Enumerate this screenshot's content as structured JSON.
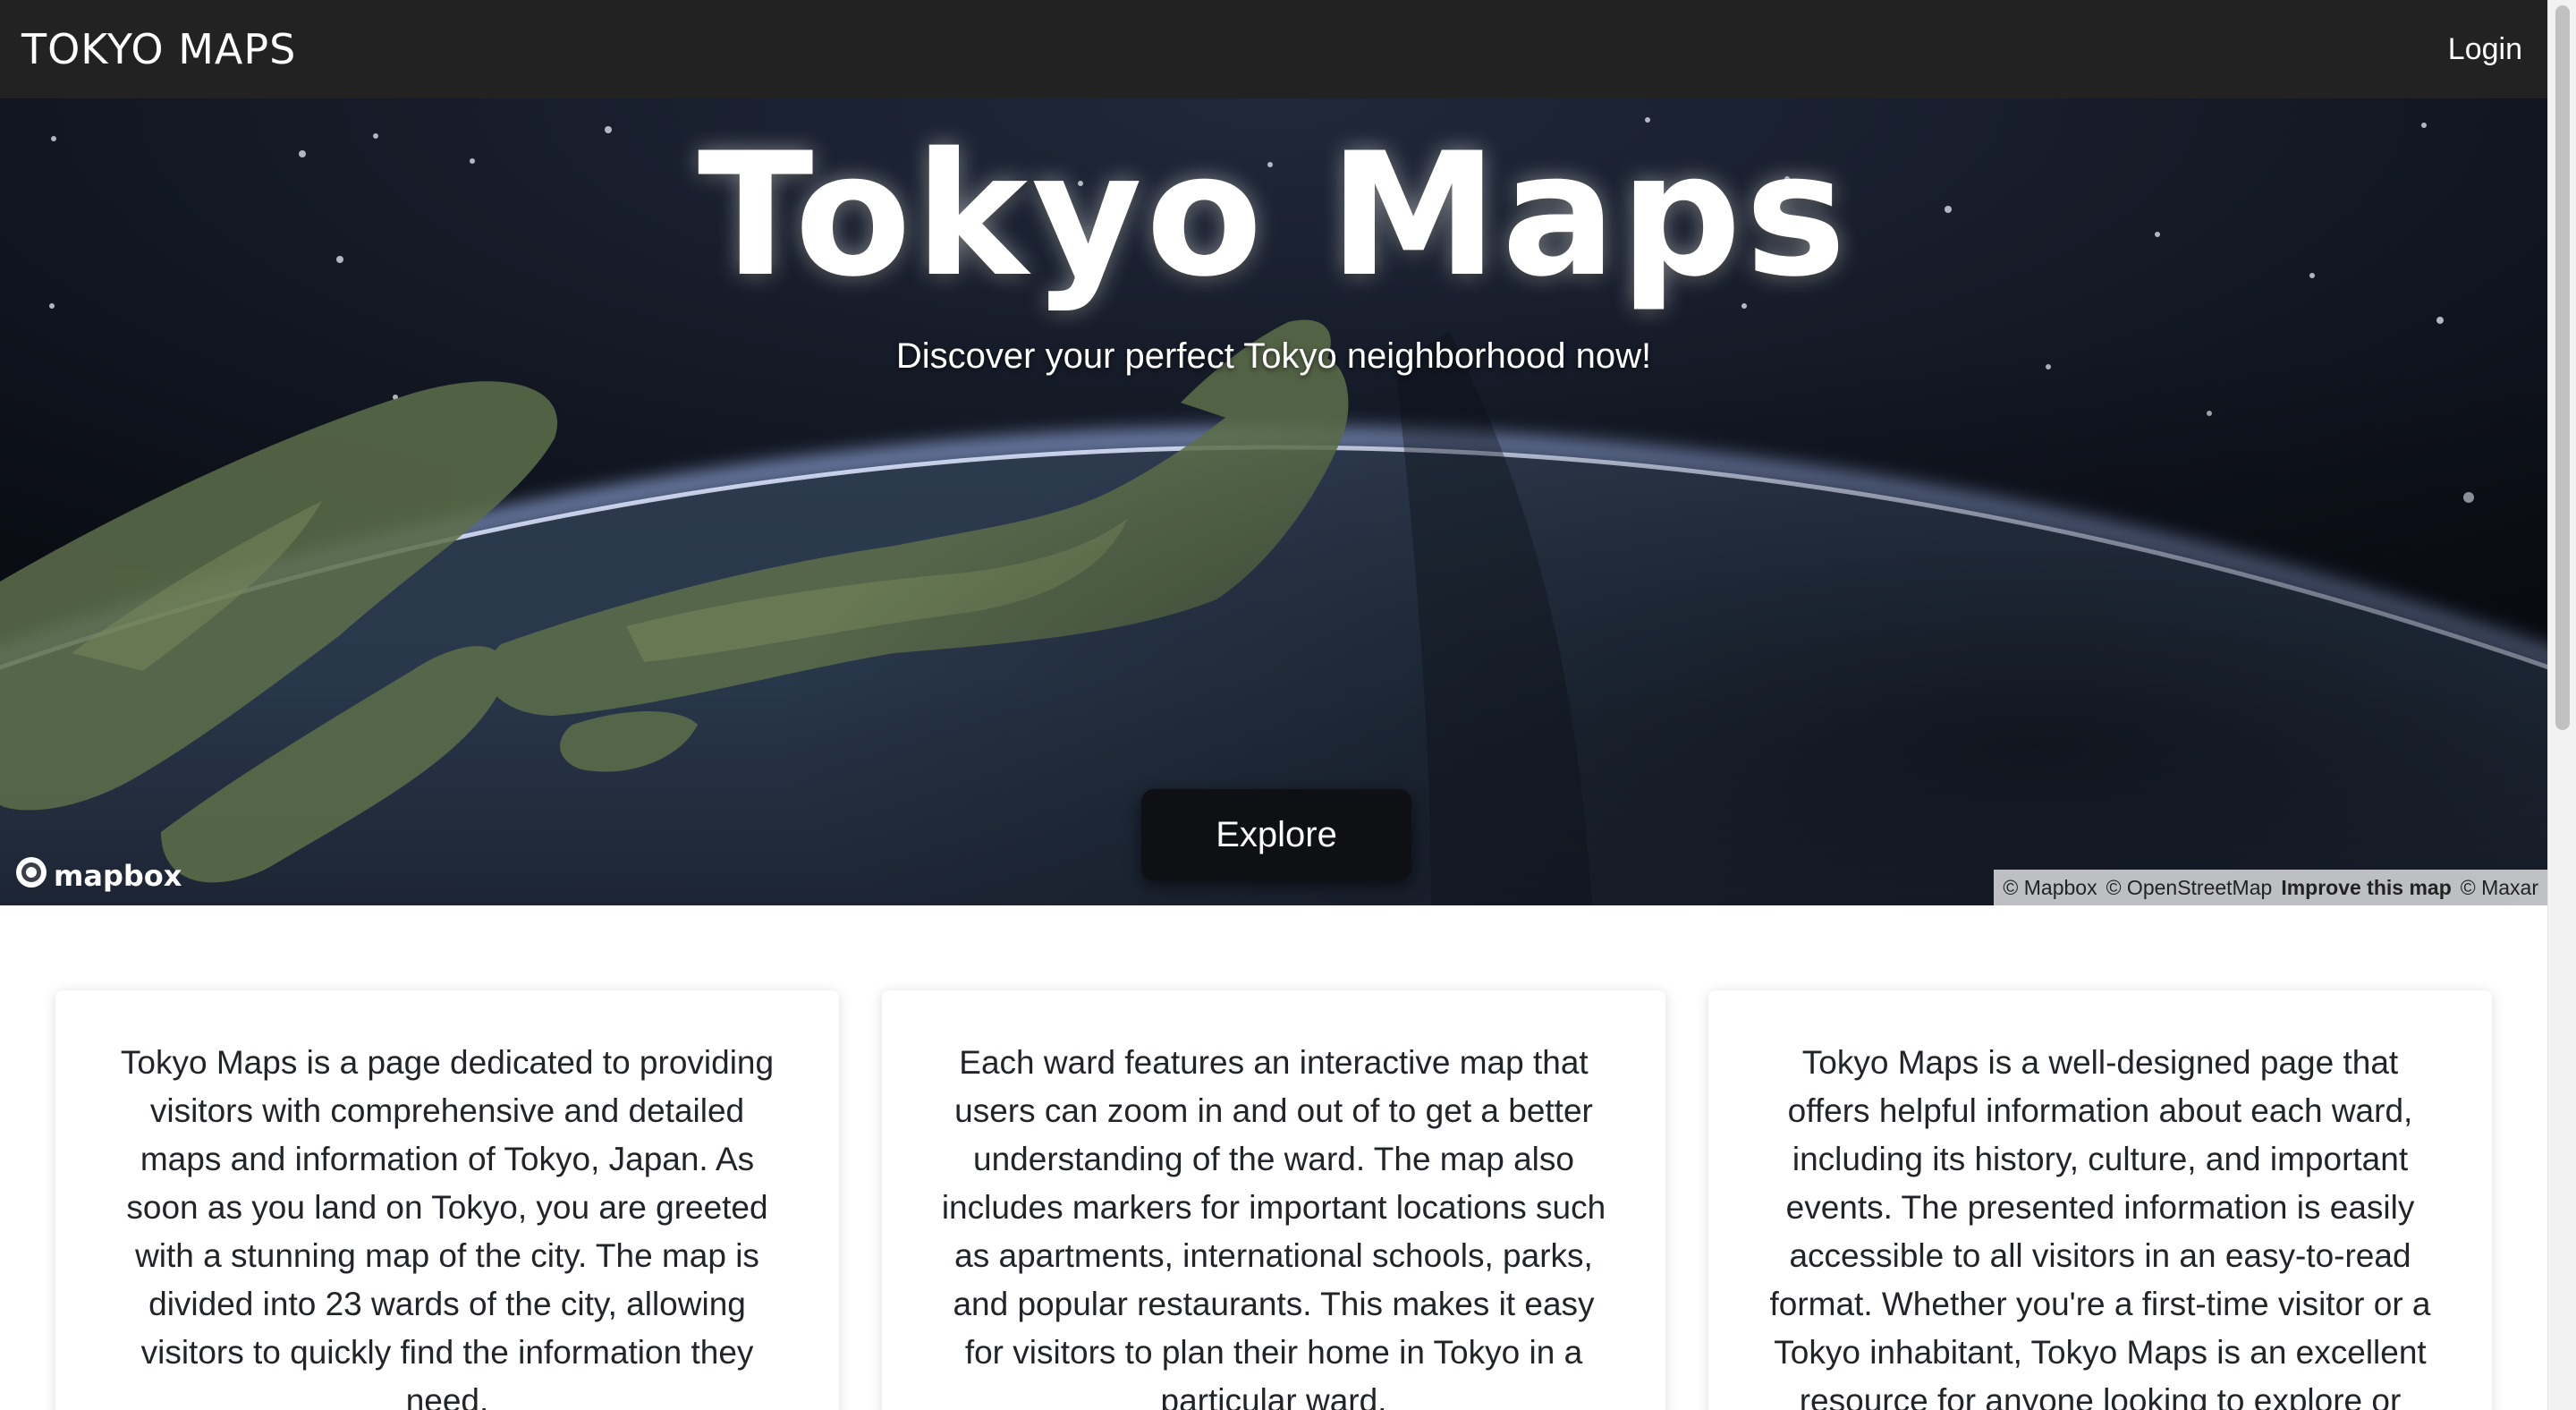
{
  "navbar": {
    "brand": "TOKYO MAPS",
    "login_label": "Login"
  },
  "hero": {
    "title": "Tokyo Maps",
    "subtitle": "Discover your perfect Tokyo neighborhood now!",
    "explore_label": "Explore"
  },
  "map": {
    "logo_text": "mapbox",
    "attribution": {
      "mapbox": "© Mapbox",
      "osm": "© OpenStreetMap",
      "improve": "Improve this map",
      "maxar": "© Maxar"
    }
  },
  "cards": [
    {
      "text": "Tokyo Maps is a page dedicated to providing visitors with comprehensive and detailed maps and information of Tokyo, Japan. As soon as you land on Tokyo, you are greeted with a stunning map of the city. The map is divided into 23 wards of the city, allowing visitors to quickly find the information they need."
    },
    {
      "text": "Each ward features an interactive map that users can zoom in and out of to get a better understanding of the ward. The map also includes markers for important locations such as apartments, international schools, parks, and popular restaurants. This makes it easy for visitors to plan their home in Tokyo in a particular ward."
    },
    {
      "text": "Tokyo Maps is a well-designed page that offers helpful information about each ward, including its history, culture, and important events. The presented information is easily accessible to all visitors in an easy-to-read format. Whether you're a first-time visitor or a Tokyo inhabitant, Tokyo Maps is an excellent resource for anyone looking to explore or settle down in the city."
    }
  ],
  "colors": {
    "navbar_bg": "#222222",
    "button_bg": "#0f1013",
    "text": "#212529"
  }
}
